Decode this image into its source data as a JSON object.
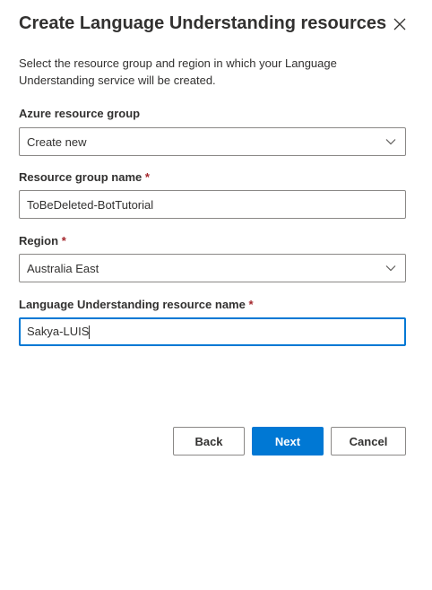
{
  "dialog": {
    "title": "Create Language Understanding resources",
    "close_icon": "close-icon",
    "description": "Select the resource group and region in which your Language Understanding service will be created."
  },
  "fields": {
    "resource_group": {
      "label": "Azure resource group",
      "value": "Create new"
    },
    "resource_group_name": {
      "label": "Resource group name",
      "required_mark": "*",
      "value": "ToBeDeleted-BotTutorial"
    },
    "region": {
      "label": "Region",
      "required_mark": "*",
      "value": "Australia East"
    },
    "luis_name": {
      "label": "Language Understanding resource name",
      "required_mark": "*",
      "value": "Sakya-LUIS"
    }
  },
  "buttons": {
    "back": "Back",
    "next": "Next",
    "cancel": "Cancel"
  },
  "colors": {
    "accent": "#0078d4",
    "required": "#a4262c",
    "border": "#8a8886",
    "text": "#323130"
  }
}
